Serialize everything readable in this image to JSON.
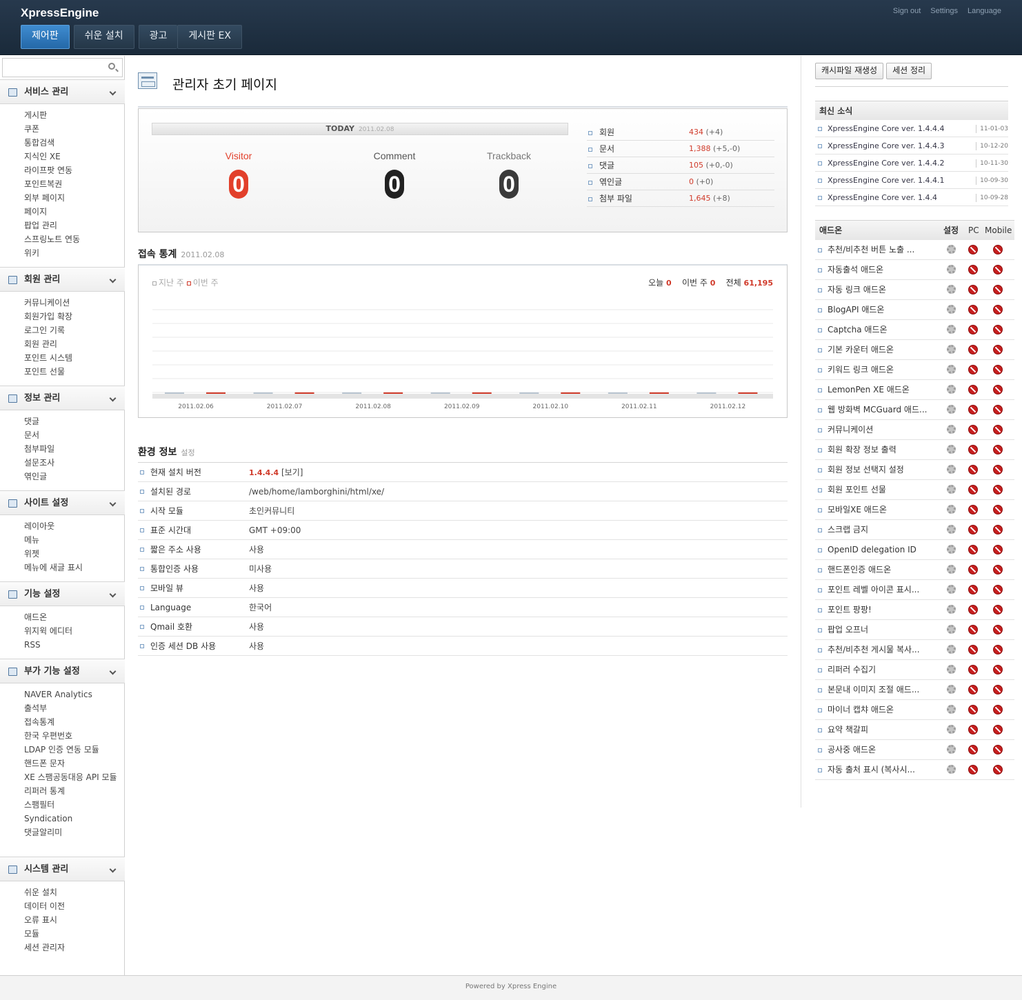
{
  "header": {
    "logo": "XpressEngine",
    "tabs": [
      "제어판",
      "쉬운 설치",
      "광고",
      "게시판 EX"
    ],
    "util": [
      "Sign out",
      "Settings",
      "Language"
    ]
  },
  "sidebar": {
    "search_placeholder": "",
    "sections": [
      {
        "title": "서비스 관리",
        "items": [
          "게시판",
          "쿠폰",
          "통합검색",
          "지식인 XE",
          "라이프팟 연동",
          "포인트복권",
          "외부 페이지",
          "페이지",
          "팝업 관리",
          "스프링노트 연동",
          "위키"
        ]
      },
      {
        "title": "회원 관리",
        "items": [
          "커뮤니케이션",
          "회원가입 확장",
          "로그인 기록",
          "회원 관리",
          "포인트 시스템",
          "포인트 선물"
        ]
      },
      {
        "title": "정보 관리",
        "items": [
          "댓글",
          "문서",
          "첨부파일",
          "설문조사",
          "엮인글"
        ]
      },
      {
        "title": "사이트 설정",
        "items": [
          "레이아웃",
          "메뉴",
          "위젯",
          "메뉴에 새글 표시"
        ]
      },
      {
        "title": "기능 설정",
        "items": [
          "애드온",
          "위지윅 에디터",
          "RSS"
        ]
      },
      {
        "title": "부가 기능 설정",
        "items": [
          "NAVER Analytics",
          "출석부",
          "접속통계",
          "한국 우편번호",
          "LDAP 인증 연동 모듈",
          "핸드폰 문자",
          "XE 스팸공동대응 API 모듈",
          "리퍼러 통계",
          "스팸필터",
          "Syndication",
          "댓글알리미"
        ]
      },
      {
        "title": "시스템 관리",
        "items": [
          "쉬운 설치",
          "데이터 이전",
          "오류 표시",
          "모듈",
          "세션 관리자"
        ]
      }
    ]
  },
  "main": {
    "title": "관리자 초기 페이지",
    "today": {
      "label": "TODAY",
      "date": "2011.02.08",
      "counters": [
        {
          "label": "Visitor",
          "value": "0",
          "color": "#e2402b"
        },
        {
          "label": "Comment",
          "value": "0",
          "color": "#222222"
        },
        {
          "label": "Trackback",
          "value": "0",
          "color": "#333333"
        }
      ],
      "stats": [
        {
          "label": "회원",
          "value": "434",
          "delta": "(+4)"
        },
        {
          "label": "문서",
          "value": "1,388",
          "delta": "(+5,-0)"
        },
        {
          "label": "댓글",
          "value": "105",
          "delta": "(+0,-0)"
        },
        {
          "label": "엮인글",
          "value": "0",
          "delta": "(+0)"
        },
        {
          "label": "첨부 파일",
          "value": "1,645",
          "delta": "(+8)"
        }
      ]
    },
    "access": {
      "title": "접속 통계",
      "date": "2011.02.08",
      "legend_last": "지난 주",
      "legend_this": "이번 주",
      "today_label": "오늘",
      "today_value": "0",
      "week_label": "이번 주",
      "week_value": "0",
      "total_label": "전체",
      "total_value": "61,195"
    },
    "env": {
      "title": "환경 정보",
      "link": "설정",
      "rows": [
        {
          "label": "현재 설치 버전",
          "value": "1.4.4.4",
          "extra": "[보기]"
        },
        {
          "label": "설치된 경로",
          "value": "/web/home/lamborghini/html/xe/"
        },
        {
          "label": "시작 모듈",
          "value": "초인커뮤니티"
        },
        {
          "label": "표준 시간대",
          "value": "GMT +09:00"
        },
        {
          "label": "짧은 주소 사용",
          "value": "사용"
        },
        {
          "label": "통합인증 사용",
          "value": "미사용"
        },
        {
          "label": "모바일 뷰",
          "value": "사용"
        },
        {
          "label": "Language",
          "value": "한국어"
        },
        {
          "label": "Qmail 호환",
          "value": "사용"
        },
        {
          "label": "인증 세션 DB 사용",
          "value": "사용"
        }
      ]
    }
  },
  "chart_data": {
    "type": "bar",
    "categories": [
      "2011.02.06",
      "2011.02.07",
      "2011.02.08",
      "2011.02.09",
      "2011.02.10",
      "2011.02.11",
      "2011.02.12"
    ],
    "series": [
      {
        "name": "지난 주",
        "values": [
          0,
          0,
          0,
          0,
          0,
          0,
          0
        ],
        "color": "#b8c4d0"
      },
      {
        "name": "이번 주",
        "values": [
          0,
          0,
          0,
          0,
          0,
          0,
          0
        ],
        "color": "#d03a2a"
      }
    ],
    "legend": "top-left",
    "grid": true
  },
  "right": {
    "buttons": [
      "캐시파일 재생성",
      "세션 정리"
    ],
    "news_title": "최신 소식",
    "news": [
      {
        "title": "XpressEngine Core ver. 1.4.4.4",
        "date": "11-01-03"
      },
      {
        "title": "XpressEngine Core ver. 1.4.4.3",
        "date": "10-12-20"
      },
      {
        "title": "XpressEngine Core ver. 1.4.4.2",
        "date": "10-11-30"
      },
      {
        "title": "XpressEngine Core ver. 1.4.4.1",
        "date": "10-09-30"
      },
      {
        "title": "XpressEngine Core ver. 1.4.4",
        "date": "10-09-28"
      }
    ],
    "addon_title": "애드온",
    "addon_cols": [
      "설정",
      "PC",
      "Mobile"
    ],
    "addons": [
      "추천/비추천 버튼 노출 ...",
      "자동출석 애드온",
      "자동 링크 애드온",
      "BlogAPI 애드온",
      "Captcha 애드온",
      "기본 카운터 애드온",
      "키워드 링크 애드온",
      "LemonPen XE 애드온",
      "웹 방화벽 MCGuard 애드...",
      "커뮤니케이션",
      "회원 확장 정보 출력",
      "회원 정보 선택지 설정",
      "회원 포인트 선물",
      "모바일XE 애드온",
      "스크랩 금지",
      "OpenID delegation ID",
      "핸드폰인증 애드온",
      "포인트 레벨 아이콘 표시...",
      "포인트 팡팡!",
      "팝업 오프너",
      "추천/비추천 게시물 복사...",
      "리퍼러 수집기",
      "본문내 이미지 조절 애드...",
      "마이너 캡챠 애드온",
      "요약 책갈피",
      "공사중 애드온",
      "자동 출처 표시 (복사시..."
    ]
  },
  "footer": {
    "text": "Powered by Xpress Engine"
  }
}
